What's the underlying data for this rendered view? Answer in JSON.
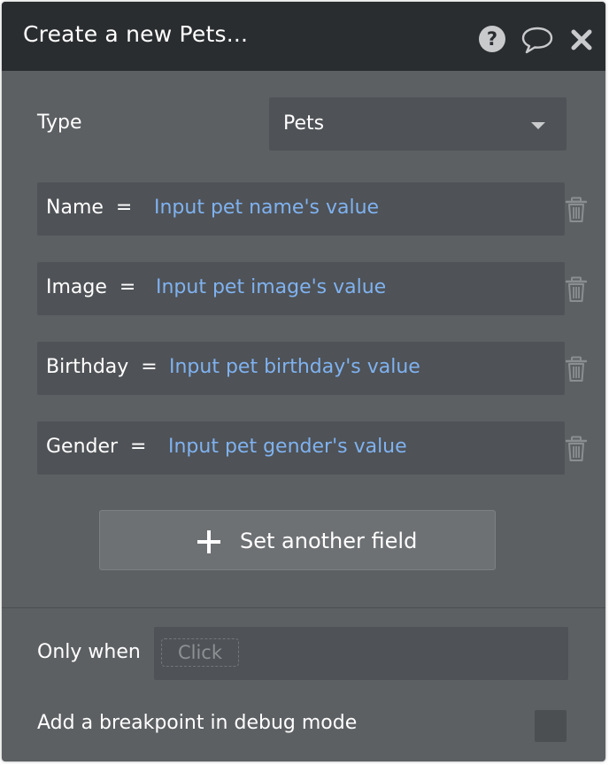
{
  "header": {
    "title": "Create a new Pets..."
  },
  "type_row": {
    "label": "Type",
    "selected": "Pets"
  },
  "fields": [
    {
      "name": "Name  =",
      "value": "Input pet name's value"
    },
    {
      "name": "Image  =",
      "value": "Input pet image's value"
    },
    {
      "name": "Birthday  =",
      "value": "Input pet birthday's value"
    },
    {
      "name": "Gender  =",
      "value": "Input pet gender's value"
    }
  ],
  "add_field": {
    "label": "Set another field"
  },
  "only_when": {
    "label": "Only when",
    "placeholder": "Click"
  },
  "breakpoint": {
    "label": "Add a breakpoint in debug mode"
  },
  "colors": {
    "header": "#2a2d30",
    "panel": "#5d6063",
    "field": "#4f5256",
    "link": "#7fb2f0"
  },
  "icons": [
    "help-icon",
    "comment-icon",
    "close-icon",
    "trash-icon",
    "plus-icon",
    "dropdown-caret-icon"
  ]
}
